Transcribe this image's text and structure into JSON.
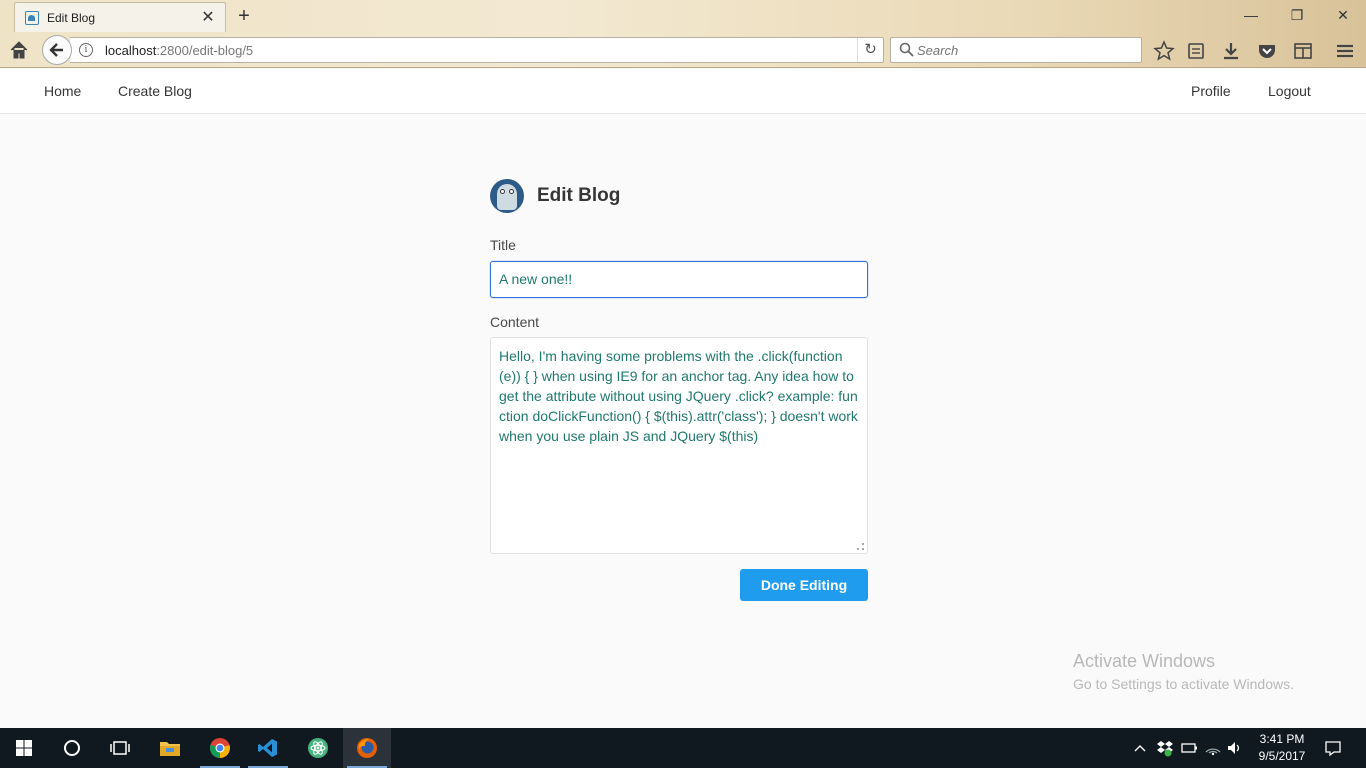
{
  "browser": {
    "tab_title": "Edit Blog",
    "url_host": "localhost",
    "url_rest": ":2800/edit-blog/5",
    "search_placeholder": "Search"
  },
  "app_nav": {
    "left": [
      "Home",
      "Create Blog"
    ],
    "right": [
      "Profile",
      "Logout"
    ]
  },
  "form": {
    "heading": "Edit Blog",
    "title_label": "Title",
    "title_value": "A new one!!",
    "content_label": "Content",
    "content_value": "Hello, I'm having some problems with the .click(function(e)) { } when using IE9 for an anchor tag. Any idea how to get the attribute without using JQuery .click? example: function doClickFunction() { $(this).attr('class'); } doesn't work when you use plain JS and JQuery $(this)",
    "submit_label": "Done Editing"
  },
  "watermark": {
    "line1": "Activate Windows",
    "line2": "Go to Settings to activate Windows."
  },
  "taskbar": {
    "time": "3:41 PM",
    "date": "9/5/2017"
  },
  "colors": {
    "primary_button": "#209cee",
    "input_focus_border": "#3273dc",
    "input_text": "#1f7a6c",
    "taskbar": "#101820"
  }
}
